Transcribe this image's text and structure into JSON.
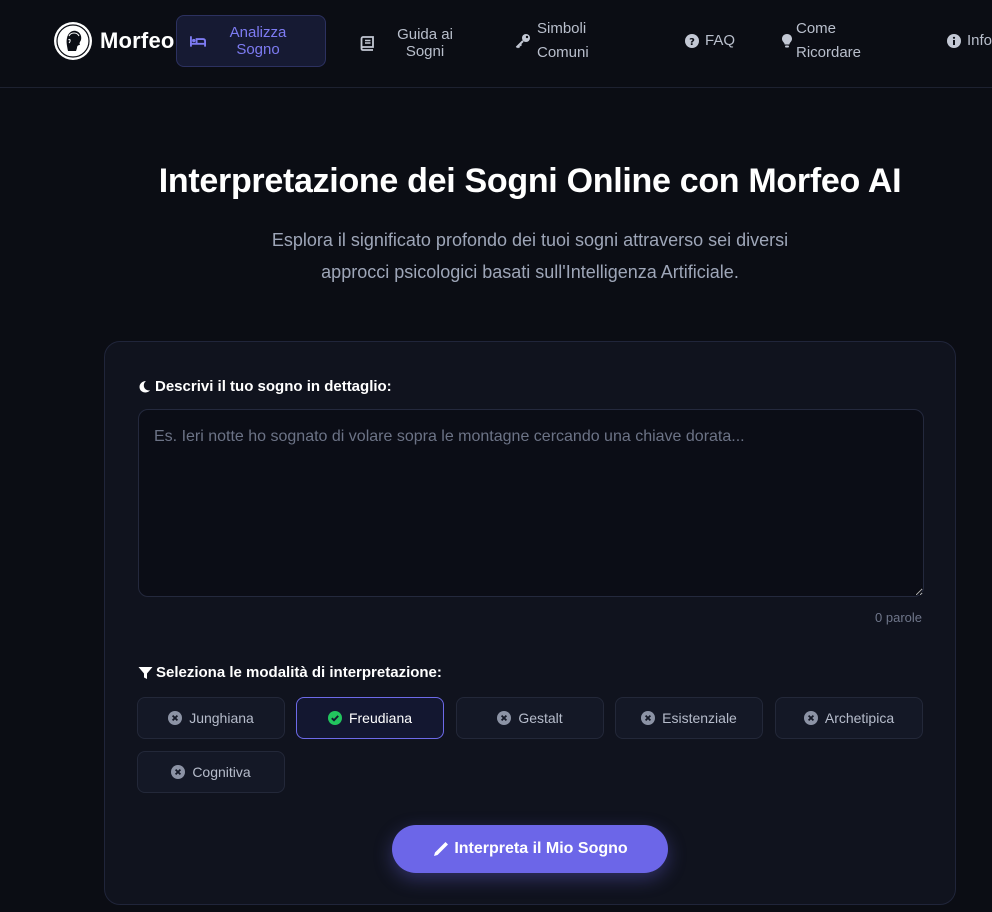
{
  "brand": {
    "name": "Morfeo"
  },
  "nav": {
    "items": [
      {
        "label": "Analizza Sogno",
        "icon": "bed-icon"
      },
      {
        "label": "Guida ai Sogni",
        "icon": "book-icon"
      },
      {
        "label": "Simboli Comuni",
        "icon": "key-icon"
      },
      {
        "label": "FAQ",
        "icon": "question-circle-icon"
      },
      {
        "label": "Come Ricordare",
        "icon": "lightbulb-icon"
      },
      {
        "label": "Info",
        "icon": "info-circle-icon"
      }
    ]
  },
  "hero": {
    "title": "Interpretazione dei Sogni Online con Morfeo AI",
    "subtitle_line1": "Esplora il significato profondo dei tuoi sogni attraverso sei diversi",
    "subtitle_line2": "approcci psicologici basati sull'Intelligenza Artificiale."
  },
  "form": {
    "dream_label": "Descrivi il tuo sogno in dettaglio:",
    "dream_value": "",
    "dream_placeholder": "Es. Ieri notte ho sognato di volare sopra le montagne cercando una chiave dorata...",
    "word_count": "0 parole",
    "modes_label": "Seleziona le modalità di interpretazione:",
    "modes": [
      {
        "label": "Junghiana",
        "selected": false
      },
      {
        "label": "Freudiana",
        "selected": true
      },
      {
        "label": "Gestalt",
        "selected": false
      },
      {
        "label": "Esistenziale",
        "selected": false
      },
      {
        "label": "Archetipica",
        "selected": false
      },
      {
        "label": "Cognitiva",
        "selected": false
      }
    ],
    "submit_label": "Interpreta il Mio Sogno"
  },
  "colors": {
    "background": "#0b0d14",
    "card": "#10131e",
    "accent": "#6c66e8",
    "selected_check": "#22c55e"
  }
}
